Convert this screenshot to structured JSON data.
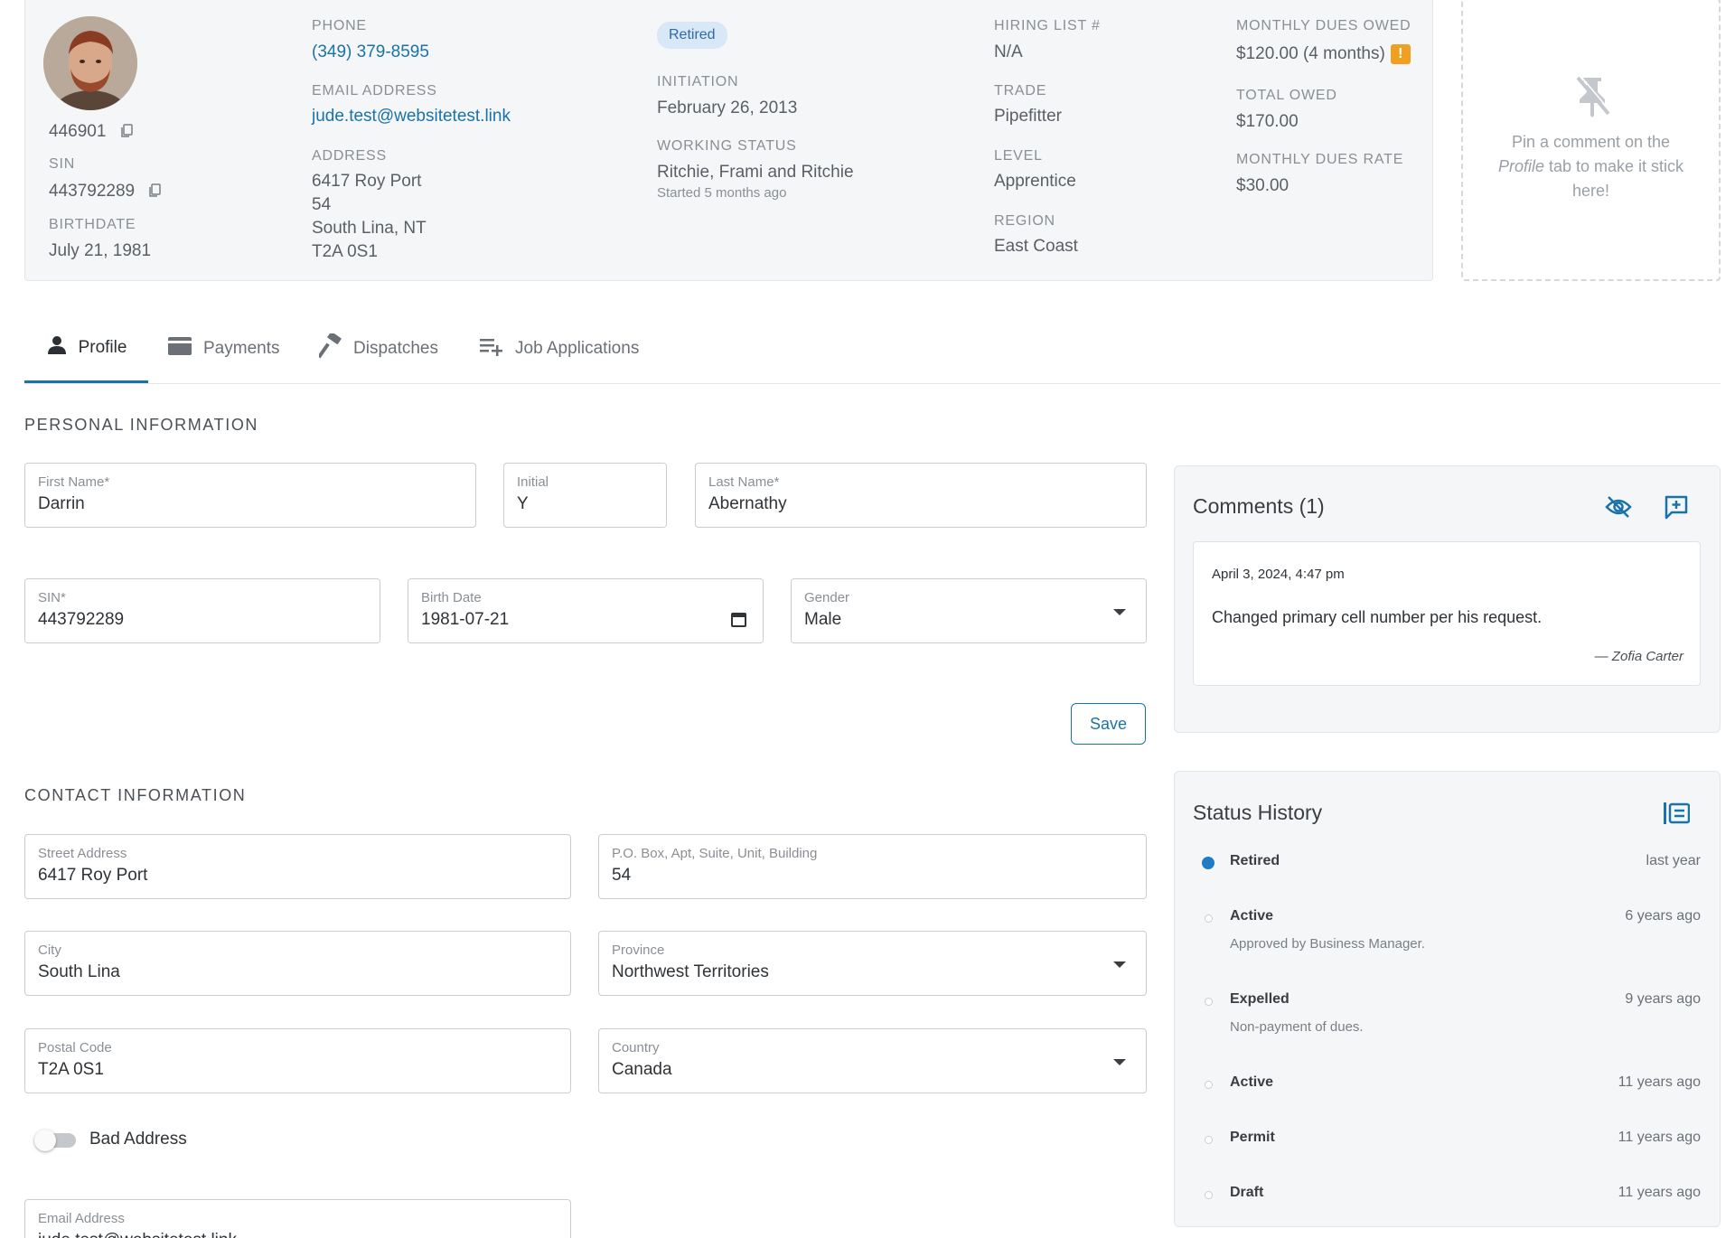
{
  "member": {
    "id": "446901",
    "sin_label": "SIN",
    "sin": "443792289",
    "birthdate_label": "BIRTHDATE",
    "birthdate": "July 21, 1981",
    "phone_label": "PHONE",
    "phone": "(349) 379-8595",
    "email_label": "EMAIL ADDRESS",
    "email": "jude.test@websitetest.link",
    "address_label": "ADDRESS",
    "address_lines": [
      "6417 Roy Port",
      "54",
      "South Lina, NT",
      "T2A 0S1"
    ],
    "status_badge": "Retired",
    "initiation_label": "INITIATION",
    "initiation": "February 26, 2013",
    "working_status_label": "WORKING STATUS",
    "working_status": "Ritchie, Frami and Ritchie",
    "working_status_sub": "Started 5 months ago",
    "hiring_list_label": "HIRING LIST #",
    "hiring_list": "N/A",
    "trade_label": "TRADE",
    "trade": "Pipefitter",
    "level_label": "LEVEL",
    "level": "Apprentice",
    "region_label": "REGION",
    "region": "East Coast",
    "dues_owed_label": "MONTHLY DUES OWED",
    "dues_owed": "$120.00 (4 months)",
    "warning_glyph": "!",
    "total_owed_label": "TOTAL OWED",
    "total_owed": "$170.00",
    "dues_rate_label": "MONTHLY DUES RATE",
    "dues_rate": "$30.00"
  },
  "pin_hint": {
    "before": "Pin a comment on the ",
    "emphasis": "Profile",
    "after": " tab to make it stick here!"
  },
  "tabs": [
    {
      "label": "Profile",
      "icon": "person-icon",
      "active": true
    },
    {
      "label": "Payments",
      "icon": "credit-card-icon",
      "active": false
    },
    {
      "label": "Dispatches",
      "icon": "hammer-icon",
      "active": false
    },
    {
      "label": "Job Applications",
      "icon": "playlist-add-icon",
      "active": false
    }
  ],
  "personal": {
    "title": "PERSONAL INFORMATION",
    "first_name_label": "First Name*",
    "first_name": "Darrin",
    "initial_label": "Initial",
    "initial": "Y",
    "last_name_label": "Last Name*",
    "last_name": "Abernathy",
    "sin_label": "SIN*",
    "sin": "443792289",
    "birth_date_label": "Birth Date",
    "birth_date": "1981-07-21",
    "gender_label": "Gender",
    "gender": "Male",
    "save_label": "Save"
  },
  "contact": {
    "title": "CONTACT INFORMATION",
    "street_label": "Street Address",
    "street": "6417 Roy Port",
    "unit_label": "P.O. Box, Apt, Suite, Unit, Building",
    "unit": "54",
    "city_label": "City",
    "city": "South Lina",
    "province_label": "Province",
    "province": "Northwest Territories",
    "postal_label": "Postal Code",
    "postal": "T2A 0S1",
    "country_label": "Country",
    "country": "Canada",
    "bad_address_label": "Bad Address",
    "bad_address": false,
    "email_label": "Email Address",
    "email": "jude.test@websitetest.link"
  },
  "comments": {
    "title": "Comments (1)",
    "items": [
      {
        "date": "April 3, 2024, 4:47 pm",
        "text": "Changed primary cell number per his request.",
        "author": "— Zofia Carter"
      }
    ]
  },
  "status_history": {
    "title": "Status History",
    "items": [
      {
        "name": "Retired",
        "time": "last year",
        "note": "",
        "current": true
      },
      {
        "name": "Active",
        "time": "6 years ago",
        "note": "Approved by Business Manager.",
        "current": false
      },
      {
        "name": "Expelled",
        "time": "9 years ago",
        "note": "Non-payment of dues.",
        "current": false
      },
      {
        "name": "Active",
        "time": "11 years ago",
        "note": "",
        "current": false
      },
      {
        "name": "Permit",
        "time": "11 years ago",
        "note": "",
        "current": false
      },
      {
        "name": "Draft",
        "time": "11 years ago",
        "note": "",
        "current": false
      }
    ]
  },
  "colors": {
    "accent": "#1a73a8",
    "badge_bg": "#d8e8f7",
    "warning": "#f0a020",
    "status_current": "#1f7bc4"
  }
}
